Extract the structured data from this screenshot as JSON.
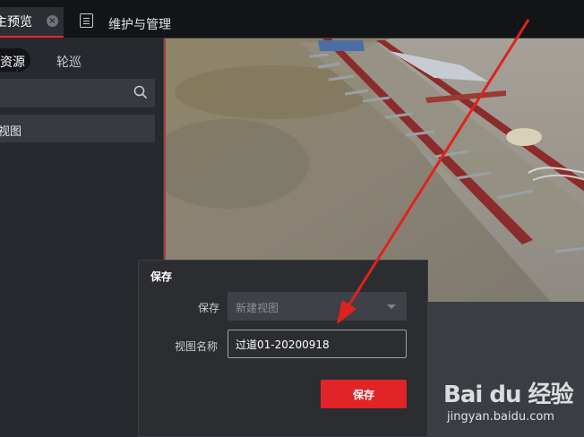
{
  "tabs": {
    "active_label": "主预览",
    "close_glyph": "×",
    "second_label": "维护与管理",
    "second_icon": "maintenance-icon"
  },
  "left_panel": {
    "segment_active": "资源",
    "segment_other": "轮巡",
    "search_icon": "search-icon",
    "view_item_label": "视图"
  },
  "dialog": {
    "title": "保存",
    "save_label": "保存",
    "save_select_placeholder": "新建视图",
    "view_name_label": "视图名称",
    "view_name_value": "过道01-20200918",
    "save_button": "保存"
  },
  "watermark": {
    "logo": "Bai du 经验",
    "subtitle": "jingyan.baidu.com"
  },
  "colors": {
    "accent_red": "#e02427",
    "tab_underline": "#e5282b",
    "panel_bg": "#26292d",
    "dialog_bg": "#2b2d31"
  }
}
